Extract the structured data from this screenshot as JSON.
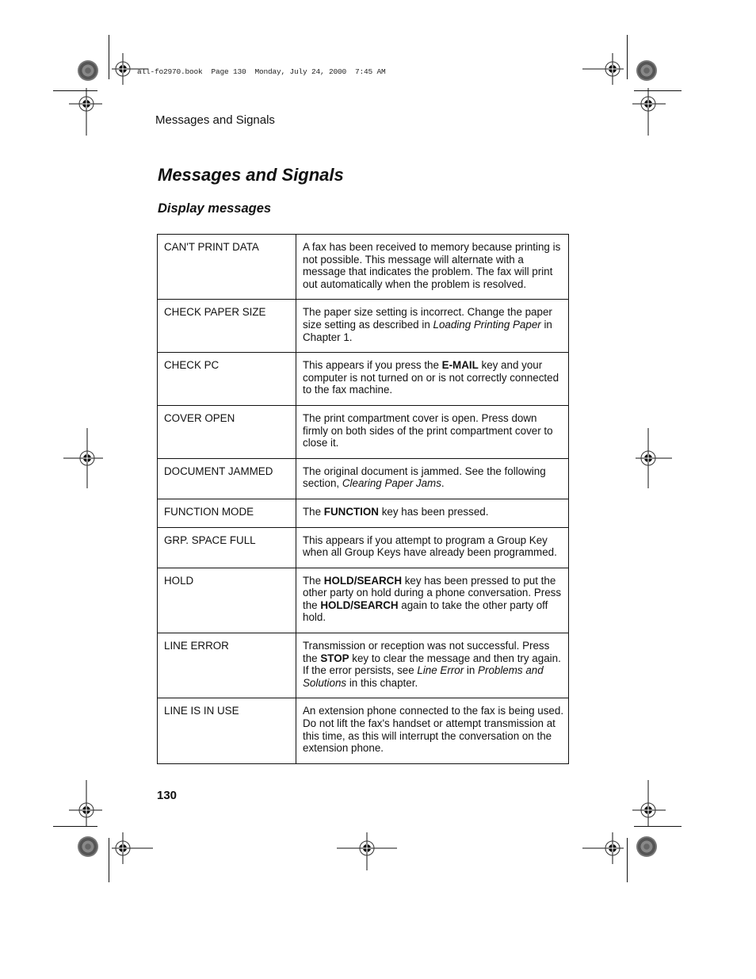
{
  "print_slug": "all-fo2970.book  Page 130  Monday, July 24, 2000  7:45 AM",
  "running_head": "Messages and Signals",
  "page_title": "Messages and Signals",
  "section_title": "Display messages",
  "rows": [
    {
      "code": "CAN'T PRINT DATA",
      "parts": [
        {
          "t": "A fax has been received to memory because printing is not possible. This message will alternate with a message that indicates the problem. The fax will print out automatically when the problem is resolved."
        }
      ]
    },
    {
      "code": "CHECK PAPER SIZE",
      "parts": [
        {
          "t": "The paper size setting is incorrect. Change the paper size setting as described in "
        },
        {
          "t": "Loading Printing Paper",
          "s": "i"
        },
        {
          "t": " in Chapter 1."
        }
      ]
    },
    {
      "code": "CHECK PC",
      "parts": [
        {
          "t": "This appears if you press the "
        },
        {
          "t": "E-MAIL",
          "s": "b"
        },
        {
          "t": " key and your computer is not turned on or is not correctly connected to the fax machine."
        }
      ]
    },
    {
      "code": "COVER OPEN",
      "parts": [
        {
          "t": "The print compartment cover is open. Press down firmly on both sides of the print compartment cover to close it."
        }
      ]
    },
    {
      "code": "DOCUMENT JAMMED",
      "parts": [
        {
          "t": "The original document is jammed. See the following section, "
        },
        {
          "t": "Clearing Paper Jams",
          "s": "i"
        },
        {
          "t": "."
        }
      ]
    },
    {
      "code": "FUNCTION MODE",
      "parts": [
        {
          "t": "The "
        },
        {
          "t": "FUNCTION",
          "s": "b"
        },
        {
          "t": " key has been pressed."
        }
      ]
    },
    {
      "code": "GRP. SPACE FULL",
      "parts": [
        {
          "t": "This appears if you attempt to program a Group Key when all Group Keys have already been programmed."
        }
      ]
    },
    {
      "code": "HOLD",
      "parts": [
        {
          "t": "The "
        },
        {
          "t": "HOLD/SEARCH",
          "s": "b"
        },
        {
          "t": " key has been pressed to put the other party on hold during a phone conversation. Press the "
        },
        {
          "t": "HOLD/SEARCH",
          "s": "b"
        },
        {
          "t": " again to take the other party off hold."
        }
      ]
    },
    {
      "code": "LINE ERROR",
      "parts": [
        {
          "t": "Transmission or reception was not successful. Press the "
        },
        {
          "t": "STOP",
          "s": "b"
        },
        {
          "t": " key to clear the message and then try again. If the error persists, see "
        },
        {
          "t": "Line Error",
          "s": "i"
        },
        {
          "t": " in "
        },
        {
          "t": "Problems and Solutions",
          "s": "i"
        },
        {
          "t": " in this chapter."
        }
      ]
    },
    {
      "code": "LINE IS IN USE",
      "parts": [
        {
          "t": "An extension phone connected to the fax is being used. Do not lift the fax's handset or attempt transmission at this time, as this will interrupt the conversation on the extension phone."
        }
      ]
    }
  ],
  "page_number": "130"
}
